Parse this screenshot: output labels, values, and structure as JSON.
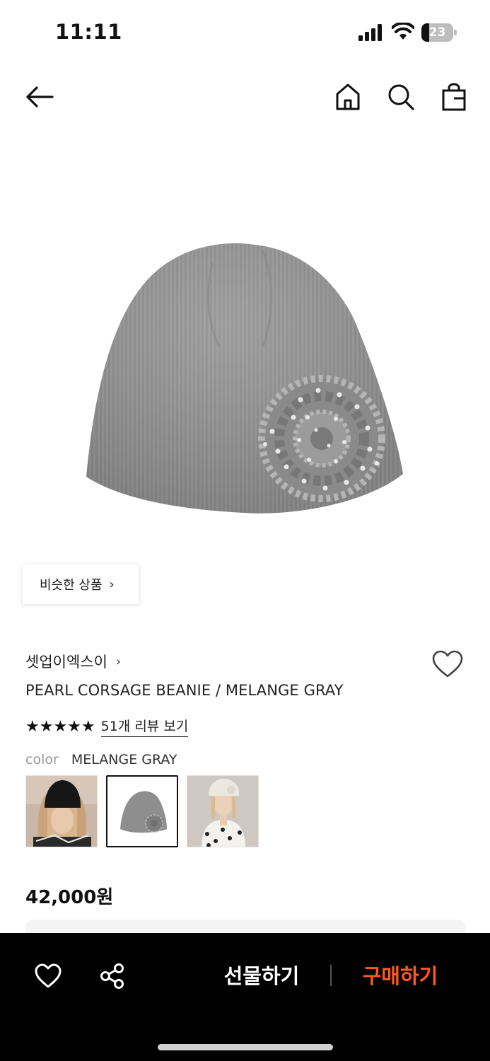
{
  "status_bar": {
    "time": "11:11",
    "battery_level": "23"
  },
  "nav": {
    "back_icon": "arrow-left-icon",
    "home_icon": "home-icon",
    "search_icon": "search-icon",
    "bag_icon": "shopping-bag-icon"
  },
  "product": {
    "similar_label": "비슷한 상품",
    "brand": "셋업이엑스이",
    "name": "PEARL CORSAGE BEANIE / MELANGE GRAY",
    "stars": "★★★★★",
    "rating": 5,
    "review_link": "51개 리뷰 보기",
    "color_label": "color",
    "color_value": "MELANGE GRAY",
    "price": "42,000원",
    "swatches": [
      {
        "name": "black-beanie",
        "selected": false
      },
      {
        "name": "melange-gray-beanie",
        "selected": true
      },
      {
        "name": "ivory-beanie",
        "selected": false
      }
    ]
  },
  "bottom_bar": {
    "wishlist_icon": "heart-icon",
    "share_icon": "share-icon",
    "gift_label": "선물하기",
    "buy_label": "구매하기"
  },
  "colors": {
    "accent": "#ff5a1f",
    "bottom_bar_bg": "#000000"
  }
}
